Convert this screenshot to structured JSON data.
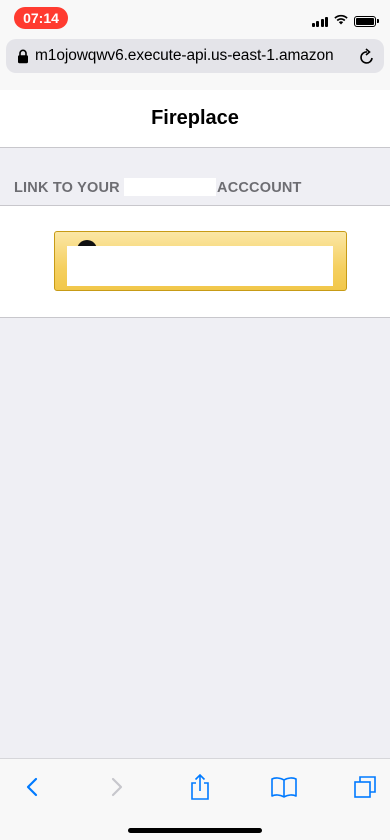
{
  "status_bar": {
    "time": "07:14",
    "time_pill_color": "#ff3b30",
    "icons": [
      "signal-icon",
      "wifi-icon",
      "battery-icon"
    ]
  },
  "browser": {
    "url": "m1ojowqwv6.execute-api.us-east-1.amazon",
    "lock_icon": "lock-icon",
    "reload_icon": "reload-icon"
  },
  "page": {
    "title": "Fireplace",
    "section_header_prefix": "LINK TO YOUR",
    "section_header_suffix": "ACCCOUNT",
    "button_color": "#f5d061"
  },
  "toolbar": {
    "items": [
      "back-icon",
      "forward-icon",
      "share-icon",
      "bookmarks-icon",
      "tabs-icon"
    ],
    "accent": "#007aff"
  }
}
